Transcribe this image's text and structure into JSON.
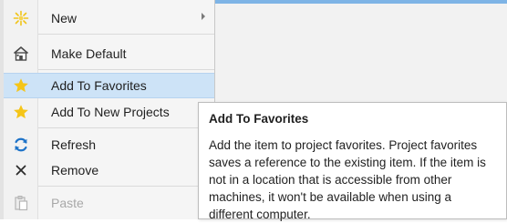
{
  "colors": {
    "accent_bar": "#7eb4e6",
    "hover_background": "#cde3f7",
    "star_yellow": "#f5c518",
    "refresh_blue": "#1e73c8",
    "disabled_text": "#a8a8a8"
  },
  "menu": {
    "items": [
      {
        "label": "New",
        "icon": "sparkle-icon",
        "has_submenu": true,
        "enabled": true
      },
      {
        "label": "Make Default",
        "icon": "home-icon",
        "enabled": true
      },
      {
        "label": "Add To Favorites",
        "icon": "star-icon",
        "enabled": true,
        "highlighted": true
      },
      {
        "label": "Add To New Projects",
        "icon": "star-icon",
        "enabled": true
      },
      {
        "label": "Refresh",
        "icon": "refresh-icon",
        "enabled": true
      },
      {
        "label": "Remove",
        "icon": "close-icon",
        "enabled": true
      },
      {
        "label": "Paste",
        "icon": "paste-icon",
        "enabled": false
      }
    ]
  },
  "tooltip": {
    "title": "Add To Favorites",
    "body": "Add the item to project favorites. Project favorites saves a reference to the existing item. If the item is not in a location that is accessible from other machines, it won't be available when using a different computer."
  }
}
